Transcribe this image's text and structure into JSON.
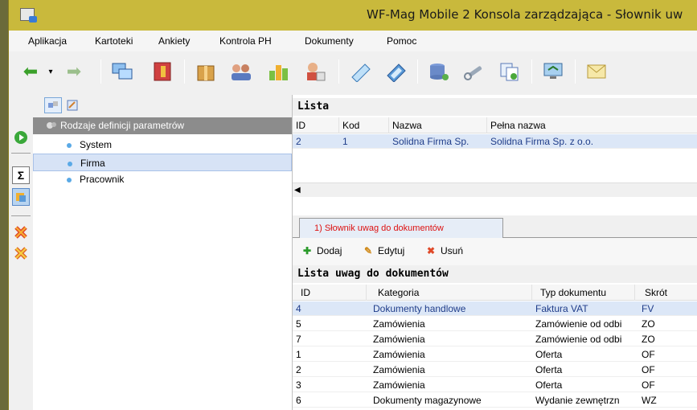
{
  "window": {
    "title": "WF-Mag Mobile 2 Konsola zarządzająca - Słownik uw"
  },
  "menu": [
    "Aplikacja",
    "Kartoteki",
    "Ankiety",
    "Kontrola PH",
    "Dokumenty",
    "Pomoc"
  ],
  "toolbar": {
    "icons": [
      "arrow-left-icon",
      "dropdown-icon",
      "arrow-right-icon",
      "computers-icon",
      "cabinet-icon",
      "package-icon",
      "users-icon",
      "chart-icon",
      "user-card-icon",
      "note-icon",
      "book-icon",
      "database-icon",
      "wrench-icon",
      "copy-icon",
      "monitor-icon",
      "envelope-icon"
    ]
  },
  "tree": {
    "root_label": "Rodzaje definicji parametrów",
    "items": [
      {
        "label": "System"
      },
      {
        "label": "Firma"
      },
      {
        "label": "Pracownik"
      }
    ]
  },
  "upper_list": {
    "title": "Lista",
    "columns": [
      "ID",
      "Kod",
      "Nazwa",
      "Pełna nazwa"
    ],
    "rows": [
      {
        "id": "2",
        "kod": "1",
        "nazwa": "Solidna Firma Sp.",
        "pelna": "Solidna Firma Sp. z o.o."
      }
    ]
  },
  "tabs": [
    {
      "label": "1) Słownik uwag do dokumentów"
    }
  ],
  "actions": {
    "add": "Dodaj",
    "edit": "Edytuj",
    "delete": "Usuń"
  },
  "lower_list": {
    "title": "Lista uwag do dokumentów",
    "columns": [
      "ID",
      "Kategoria",
      "Typ dokumentu",
      "Skrót"
    ],
    "rows": [
      {
        "id": "4",
        "kategoria": "Dokumenty handlowe",
        "typ": "Faktura VAT",
        "skrot": "FV"
      },
      {
        "id": "5",
        "kategoria": "Zamówienia",
        "typ": "Zamówienie od odbi",
        "skrot": "ZO"
      },
      {
        "id": "7",
        "kategoria": "Zamówienia",
        "typ": "Zamówienie od odbi",
        "skrot": "ZO"
      },
      {
        "id": "1",
        "kategoria": "Zamówienia",
        "typ": "Oferta",
        "skrot": "OF"
      },
      {
        "id": "2",
        "kategoria": "Zamówienia",
        "typ": "Oferta",
        "skrot": "OF"
      },
      {
        "id": "3",
        "kategoria": "Zamówienia",
        "typ": "Oferta",
        "skrot": "OF"
      },
      {
        "id": "6",
        "kategoria": "Dokumenty magazynowe",
        "typ": "Wydanie zewnętrzn",
        "skrot": "WZ"
      }
    ]
  },
  "colors": {
    "titlebar": "#c9b93c",
    "selection": "#dce7f7",
    "tab_text": "#dd1111",
    "link_text": "#1f3d8a"
  }
}
